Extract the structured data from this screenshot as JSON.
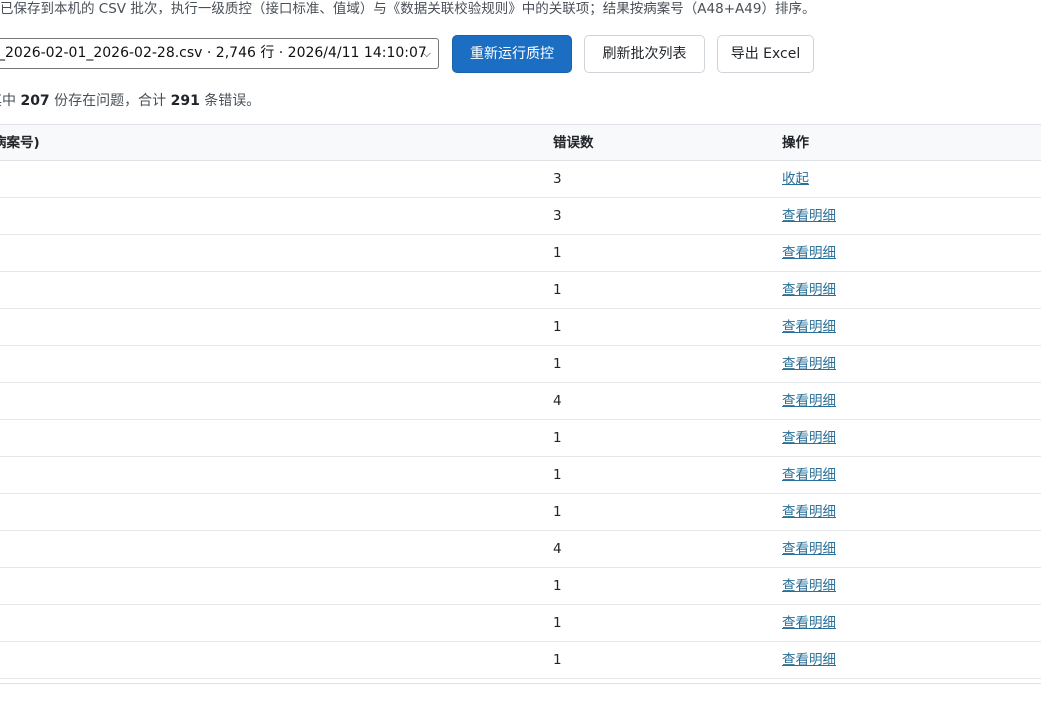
{
  "description": "已保存到本机的 CSV 批次，执行一级质控（接口标准、值域）与《数据关联校验规则》中的关联项；结果按病案号（A48+A49）排序。",
  "toolbar": {
    "batch_select_value": "_2026-02-01_2026-02-28.csv · 2,746 行 · 2026/4/11 14:10:07",
    "rerun_label": "重新运行质控",
    "refresh_label": "刷新批次列表",
    "export_label": "导出 Excel"
  },
  "summary": {
    "prefix": "其中",
    "problem_count": "207",
    "middle": "份存在问题，合计",
    "error_count": "291",
    "suffix": "条错误。"
  },
  "table": {
    "headers": {
      "id": "病案号)",
      "errors": "错误数",
      "action": "操作"
    },
    "rows": [
      {
        "errors": "3",
        "action": "收起"
      },
      {
        "errors": "3",
        "action": "查看明细"
      },
      {
        "errors": "1",
        "action": "查看明细"
      },
      {
        "errors": "1",
        "action": "查看明细"
      },
      {
        "errors": "1",
        "action": "查看明细"
      },
      {
        "errors": "1",
        "action": "查看明细"
      },
      {
        "errors": "4",
        "action": "查看明细"
      },
      {
        "errors": "1",
        "action": "查看明细"
      },
      {
        "errors": "1",
        "action": "查看明细"
      },
      {
        "errors": "1",
        "action": "查看明细"
      },
      {
        "errors": "4",
        "action": "查看明细"
      },
      {
        "errors": "1",
        "action": "查看明细"
      },
      {
        "errors": "1",
        "action": "查看明细"
      },
      {
        "errors": "1",
        "action": "查看明细"
      }
    ]
  }
}
